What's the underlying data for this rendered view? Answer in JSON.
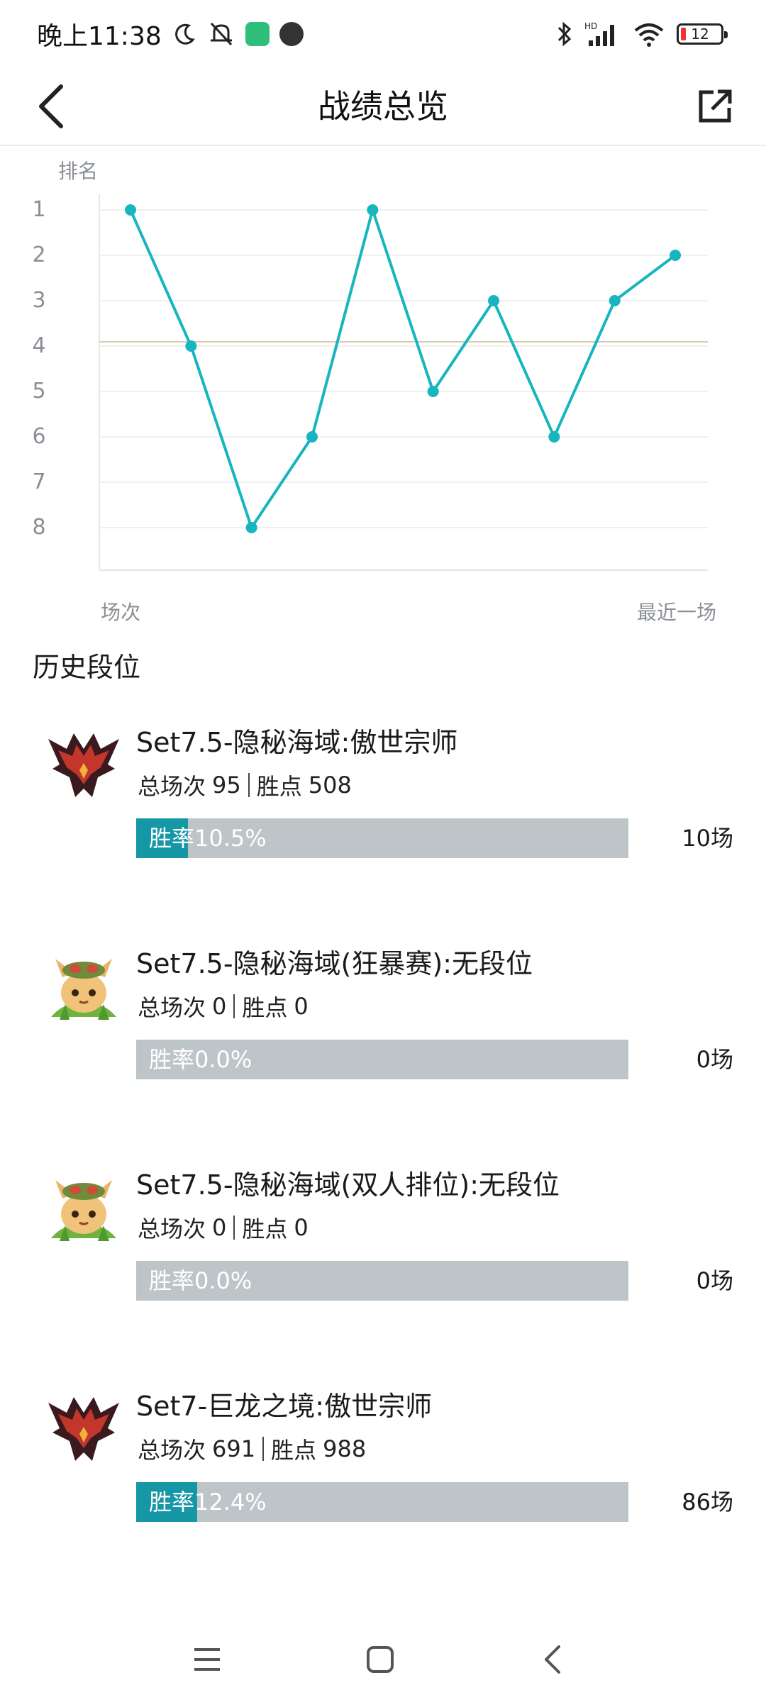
{
  "status_bar": {
    "time": "晚上11:38",
    "battery": "12",
    "icons": [
      "moon-icon",
      "mute-icon",
      "app-notification-icon",
      "app-notification-icon",
      "bluetooth-icon",
      "hd-signal-icon",
      "wifi-icon",
      "battery-icon"
    ]
  },
  "header": {
    "title": "战绩总览",
    "back_icon": "chevron-left-icon",
    "share_icon": "share-external-icon"
  },
  "chart_data": {
    "type": "line",
    "ylabel": "排名",
    "x_start_label": "场次",
    "x_end_label": "最近一场",
    "y_ticks": [
      "1",
      "2",
      "3",
      "4",
      "5",
      "6",
      "7",
      "8"
    ],
    "ylim": [
      1,
      8
    ],
    "y_inverted": true,
    "reference_line": 4,
    "series": [
      {
        "values": [
          1,
          4,
          8,
          6,
          1,
          5,
          3,
          6,
          3,
          2
        ]
      }
    ],
    "colors": {
      "line": "#17b5bf",
      "reference": "#d9cdb0",
      "grid": "#f0f0f0"
    }
  },
  "history": {
    "title": "历史段位",
    "items": [
      {
        "icon": "master-rank-emblem-icon",
        "name": "Set7.5-隐秘海域:傲世宗师",
        "games_label": "总场次",
        "games": "95",
        "points_label": "胜点",
        "points": "508",
        "winrate_text": "胜率10.5%",
        "winrate": 0.105,
        "wins": "10场"
      },
      {
        "icon": "teemo-unranked-icon",
        "name": "Set7.5-隐秘海域(狂暴赛):无段位",
        "games_label": "总场次",
        "games": "0",
        "points_label": "胜点",
        "points": "0",
        "winrate_text": "胜率0.0%",
        "winrate": 0.0,
        "wins": "0场"
      },
      {
        "icon": "teemo-unranked-icon",
        "name": "Set7.5-隐秘海域(双人排位):无段位",
        "games_label": "总场次",
        "games": "0",
        "points_label": "胜点",
        "points": "0",
        "winrate_text": "胜率0.0%",
        "winrate": 0.0,
        "wins": "0场"
      },
      {
        "icon": "master-rank-emblem-icon",
        "name": "Set7-巨龙之境:傲世宗师",
        "games_label": "总场次",
        "games": "691",
        "points_label": "胜点",
        "points": "988",
        "winrate_text": "胜率12.4%",
        "winrate": 0.124,
        "wins": "86场"
      }
    ]
  },
  "nav_bar": {
    "icons": [
      "menu-icon",
      "home-square-icon",
      "back-triangle-icon"
    ]
  },
  "colors": {
    "accent": "#1697a6",
    "bar_bg": "#bec5c8",
    "line": "#17b5bf"
  }
}
